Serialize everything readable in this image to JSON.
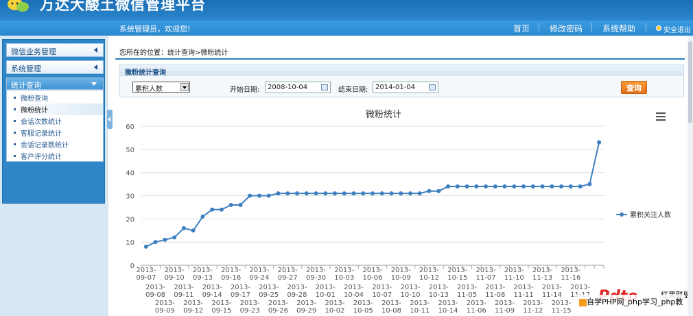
{
  "app": {
    "title": "万达大酸土微信管理平台",
    "welcome": "系统管理员，欢迎您!"
  },
  "nav": {
    "home": "首页",
    "change_password": "修改密码",
    "help": "系统帮助",
    "logout": "安全退出"
  },
  "sidebar": {
    "sections": [
      {
        "label": "微信业务管理"
      },
      {
        "label": "系统管理"
      },
      {
        "label": "统计查询"
      }
    ],
    "items": [
      {
        "label": "微粉查询"
      },
      {
        "label": "微粉统计"
      },
      {
        "label": "会话次数统计"
      },
      {
        "label": "客服记录统计"
      },
      {
        "label": "会话记录数统计"
      },
      {
        "label": "客户评分统计"
      }
    ]
  },
  "breadcrumb": "您所在的位置：统计查询>微粉统计",
  "query": {
    "panel_title": "微粉统计查询",
    "metric": "累积人数",
    "start_label": "开始日期:",
    "start_value": "2008-10-04",
    "end_label": "结束日期:",
    "end_value": "2014-01-04",
    "submit": "查询"
  },
  "chart_data": {
    "type": "line",
    "title": "微粉统计",
    "ylim": [
      0,
      60
    ],
    "yticks": [
      0,
      10,
      20,
      30,
      40,
      50,
      60
    ],
    "grid": true,
    "legend_position": "right",
    "series": [
      {
        "name": "累积关注人数",
        "color": "#3d7fc0",
        "values": [
          8,
          10,
          11,
          12,
          16,
          15,
          21,
          24,
          24,
          26,
          26,
          30,
          30,
          30,
          31,
          31,
          31,
          31,
          31,
          31,
          31,
          31,
          31,
          31,
          31,
          31,
          31,
          31,
          31,
          31,
          32,
          32,
          34,
          34,
          34,
          34,
          34,
          34,
          34,
          34,
          34,
          34,
          34,
          34,
          34,
          34,
          34,
          35,
          53
        ]
      }
    ],
    "x_label_rows": [
      [
        "2013-09-07",
        "2013-09-10",
        "2013-09-13",
        "2013-09-16",
        "2013-09-24",
        "2013-09-27",
        "2013-09-30",
        "2013-10-03",
        "2013-10-06",
        "2013-10-09",
        "2013-10-12",
        "2013-10-15",
        "2013-11-07",
        "2013-11-10",
        "2013-11-13",
        "2013-11-16"
      ],
      [
        "2013-09-08",
        "2013-09-11",
        "2013-09-14",
        "2013-09-17",
        "2013-09-25",
        "2013-09-28",
        "2013-10-01",
        "2013-10-04",
        "2013-10-07",
        "2013-10-10",
        "2013-10-13",
        "2013-11-05",
        "2013-11-08",
        "2013-11-11",
        "2013-11-14",
        "2013-11-17"
      ],
      [
        "2013-09-09",
        "2013-09-12",
        "2013-09-15",
        "2013-09-23",
        "2013-09-26",
        "2013-09-29",
        "2013-10-02",
        "2013-10-05",
        "2013-10-08",
        "2013-10-11",
        "2013-10-14",
        "2013-11-06",
        "2013-11-09",
        "2013-11-12",
        "2013-11-15"
      ]
    ]
  },
  "watermark": {
    "logo": "Pdto",
    "brand": "红黑联盟",
    "text": "自学PHP网_php学习_php教"
  }
}
